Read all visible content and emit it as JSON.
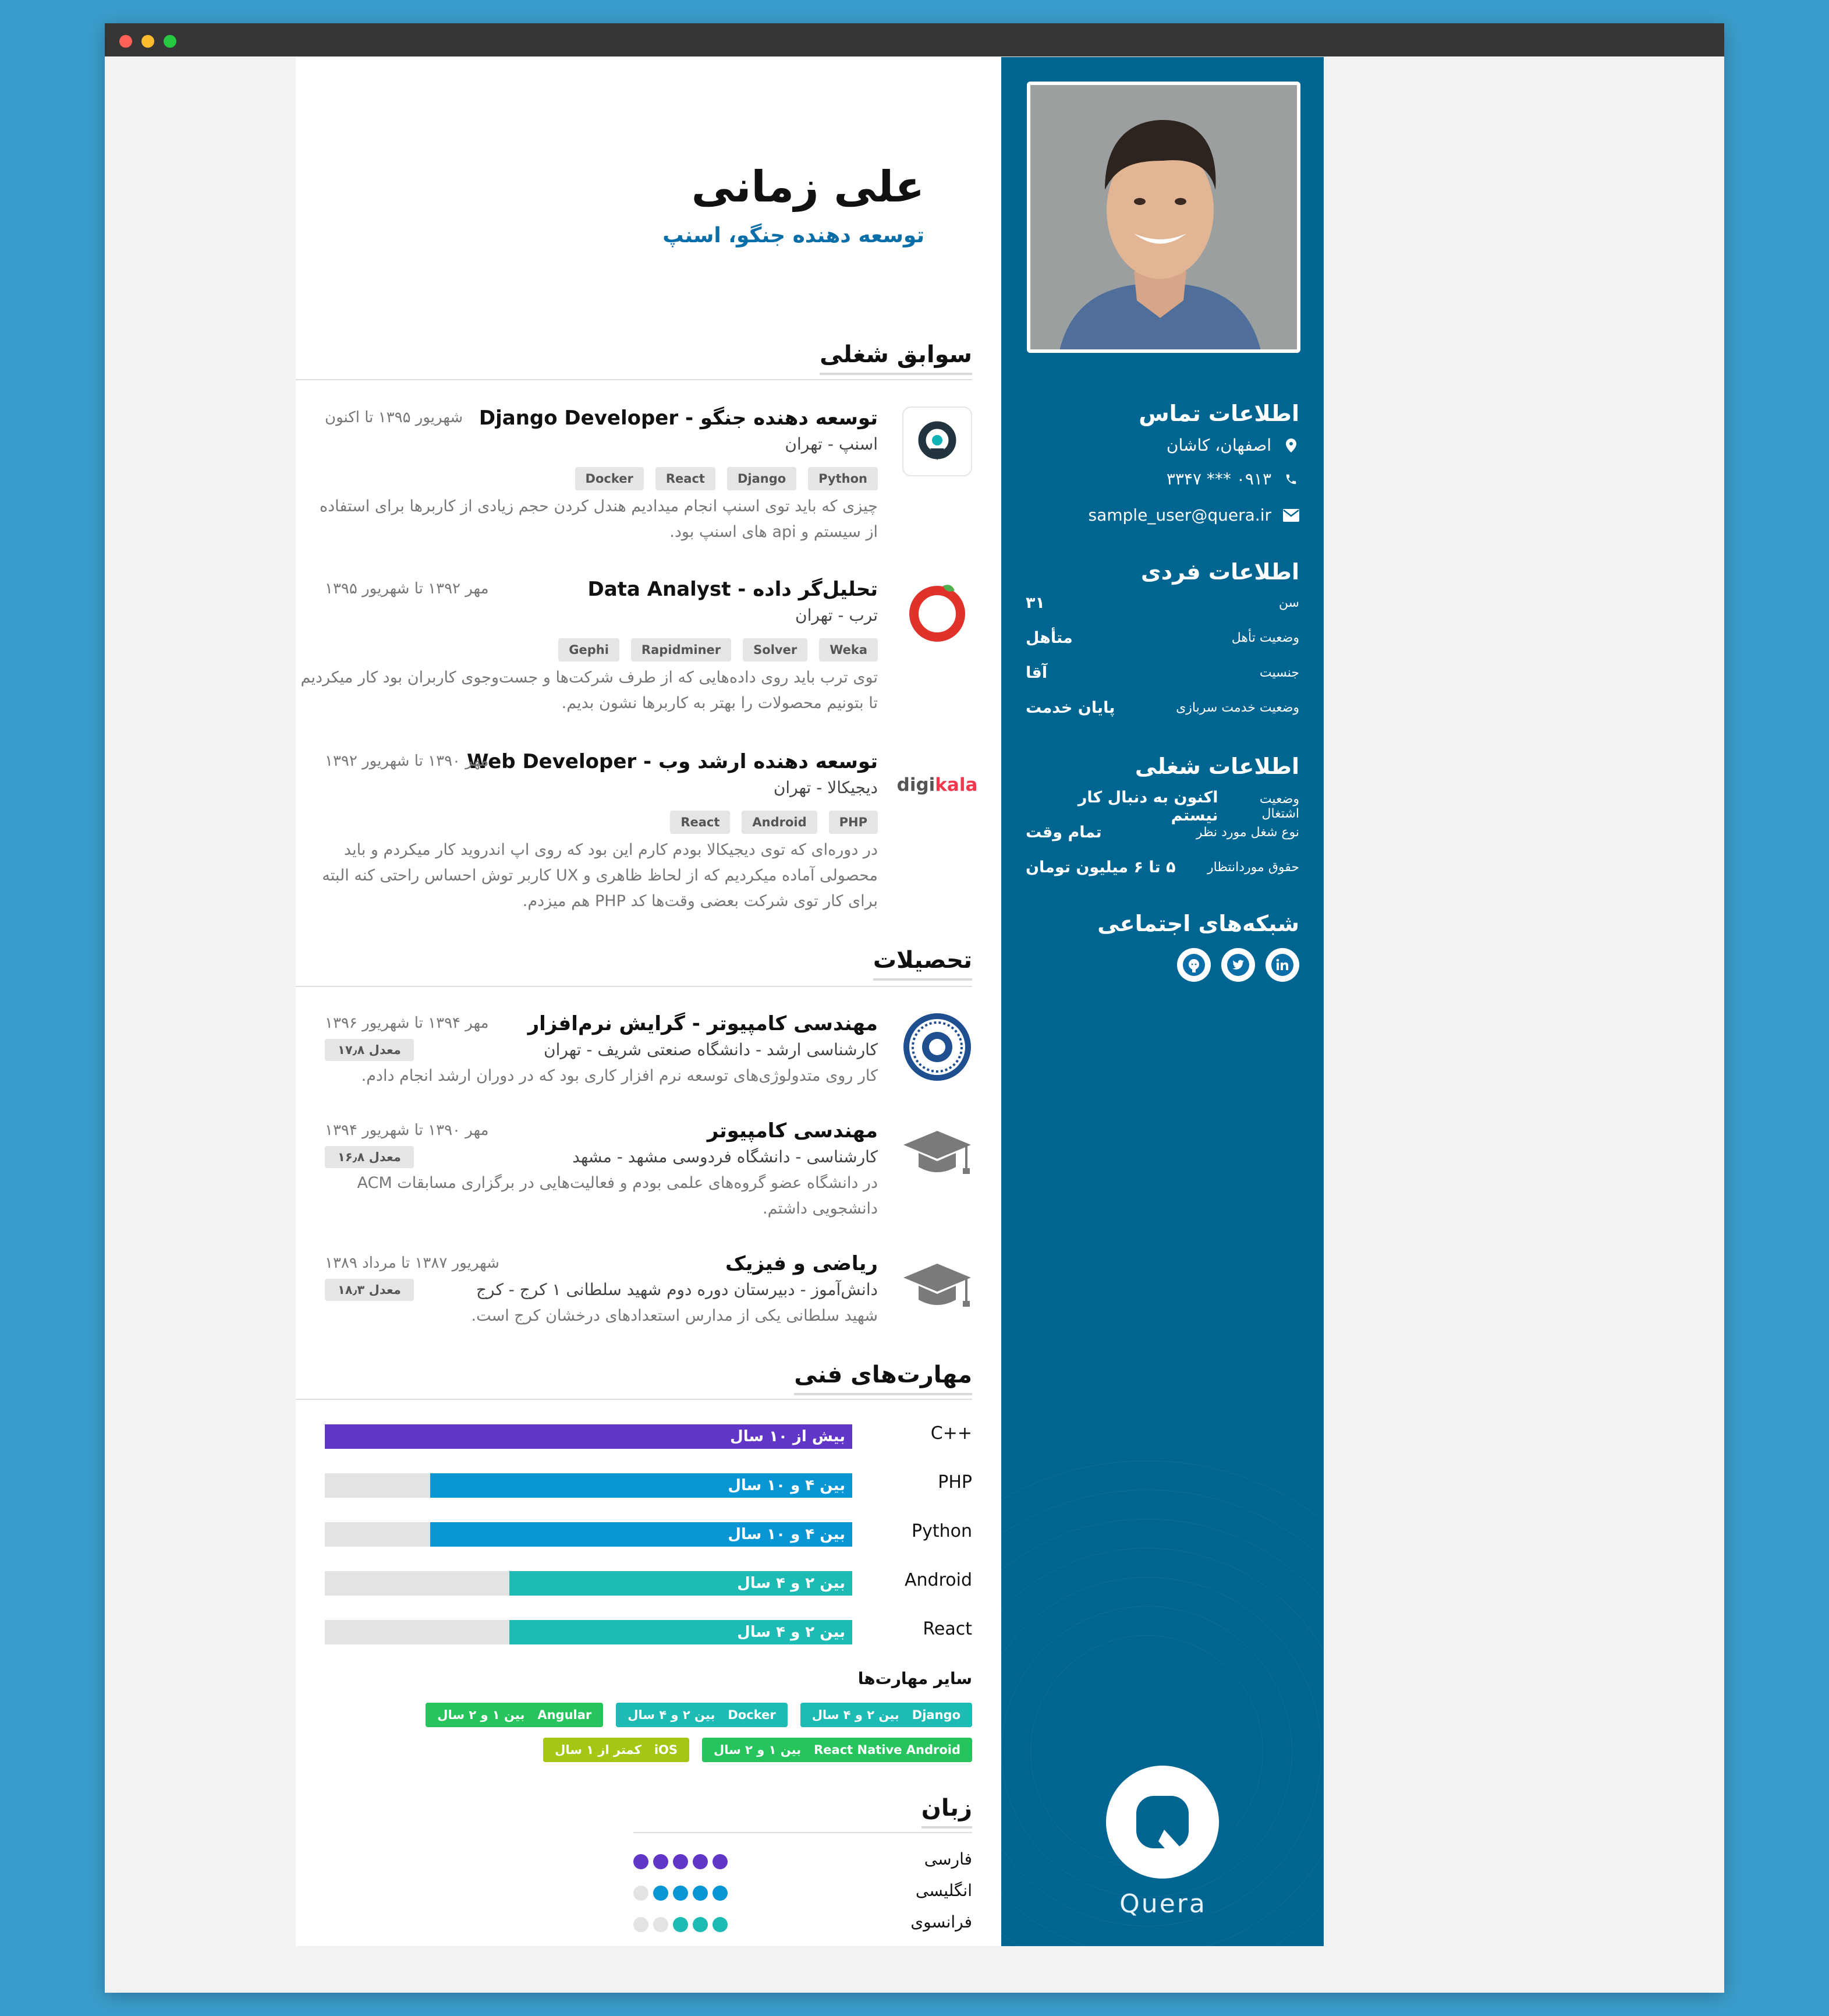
{
  "colors": {
    "sidebar": "#006591",
    "accent": "#0a6fa8",
    "purple": "#6235c9",
    "blue": "#0896d4",
    "teal": "#1ebab4",
    "green": "#27c45e",
    "lime": "#a5c713"
  },
  "header": {
    "name": "علی زمانی",
    "title": "توسعه دهنده جنگو، اسنپ"
  },
  "contact": {
    "heading": "اطلاعات تماس",
    "location": "اصفهان، کاشان",
    "phone": "۰۹۱۳ *** ۳۳۴۷",
    "email": "sample_user@quera.ir"
  },
  "personal": {
    "heading": "اطلاعات فردی",
    "rows": [
      {
        "k": "سن",
        "v": "۳۱"
      },
      {
        "k": "وضعیت تأهل",
        "v": "متأهل"
      },
      {
        "k": "جنسیت",
        "v": "آقا"
      },
      {
        "k": "وضعیت خدمت سربازی",
        "v": "پایان خدمت"
      }
    ]
  },
  "career": {
    "heading": "اطلاعات شغلی",
    "rows": [
      {
        "k": "وضعیت اشتغال",
        "v": "اکنون به دنبال کار نیستم"
      },
      {
        "k": "نوع شغل مورد نظر",
        "v": "تمام وقت"
      },
      {
        "k": "حقوق موردانتظار",
        "v": "۵ تا ۶ میلیون تومان"
      }
    ]
  },
  "social": {
    "heading": "شبکه‌های اجتماعی",
    "icons": [
      "linkedin-icon",
      "twitter-icon",
      "github-icon"
    ]
  },
  "brand": {
    "word": "Quera"
  },
  "experience": {
    "heading": "سوابق شغلی",
    "items": [
      {
        "title": "توسعه دهنده جنگو - Django Developer",
        "date": "شهریور ۱۳۹۵ تا اکنون",
        "company": "اسنپ - تهران",
        "tags": [
          "Python",
          "Django",
          "React",
          "Docker"
        ],
        "desc": [
          "چیزی که باید توی اسنپ انجام میدادیم هندل کردن حجم زیادی از کاربرها برای استفاده",
          "از سیستم و api های اسنپ بود."
        ],
        "logo": "snapp-logo"
      },
      {
        "title": "تحلیل‌گر داده - Data Analyst",
        "date": "مهر ۱۳۹۲ تا شهریور ۱۳۹۵",
        "company": "ترب - تهران",
        "tags": [
          "Weka",
          "Solver",
          "Rapidminer",
          "Gephi"
        ],
        "desc": [
          "توی ترب باید روی داده‌هایی که از طرف شرکت‌ها و جست‌وجوی کاربران بود کار میکردیم",
          "تا بتونیم محصولات را بهتر به کاربرها نشون بدیم."
        ],
        "logo": "torob-logo"
      },
      {
        "title": "توسعه دهنده ارشد وب - Web Developer",
        "date": "مهر ۱۳۹۰ تا شهریور ۱۳۹۲",
        "company": "دیجیکالا - تهران",
        "tags": [
          "PHP",
          "Android",
          "React"
        ],
        "desc": [
          "در دوره‌ای که توی دیجیکالا بودم کارم این بود که روی اپ اندروید کار میکردم و باید",
          "محصولی آماده میکردیم که از لحاظ ظاهری و UX کاربر توش احساس راحتی کنه البته",
          "برای کار توی شرکت بعضی وقت‌ها کد PHP هم میزدم."
        ],
        "logo": "digikala-logo",
        "logo_text_a": "digi",
        "logo_text_b": "kala"
      }
    ]
  },
  "education": {
    "heading": "تحصیلات",
    "items": [
      {
        "title": "مهندسی کامپیوتر - گرایش نرم‌افزار",
        "date": "مهر ۱۳۹۴ تا شهریور ۱۳۹۶",
        "school": "کارشناسی ارشد - دانشگاه صنعتی شریف - تهران",
        "gpa": "معدل ۱۷٫۸",
        "desc": [
          "کار روی متدولوژی‌های توسعه نرم افزار کاری بود که در دوران ارشد انجام دادم."
        ],
        "logo": "sharif-logo"
      },
      {
        "title": "مهندسی کامپیوتر",
        "date": "مهر ۱۳۹۰ تا شهریور ۱۳۹۴",
        "school": "کارشناسی - دانشگاه فردوسی مشهد - مشهد",
        "gpa": "معدل ۱۶٫۸",
        "desc": [
          "در دانشگاه عضو گروه‌های علمی بودم و فعالیت‌هایی در برگزاری مسابقات ACM",
          "دانشجویی داشتم."
        ],
        "logo": "graduation-cap-icon"
      },
      {
        "title": "ریاضی و فیزیک",
        "date": "شهریور ۱۳۸۷ تا مرداد ۱۳۸۹",
        "school": "دانش‌آموز - دبیرستان دوره دوم شهید سلطانی ۱ کرج - کرج",
        "gpa": "معدل ۱۸٫۳",
        "desc": [
          "شهید سلطانی یکی از مدارس استعدادهای درخشان کرج است."
        ],
        "logo": "graduation-cap-icon"
      }
    ]
  },
  "skills": {
    "heading": "مهارت‌های فنی",
    "items": [
      {
        "name": "C++",
        "label": "بیش از ۱۰ سال",
        "level": 1.0,
        "color": "#6235c9"
      },
      {
        "name": "PHP",
        "label": "بین ۴ و ۱۰ سال",
        "level": 0.8,
        "color": "#0896d4"
      },
      {
        "name": "Python",
        "label": "بین ۴ و ۱۰ سال",
        "level": 0.8,
        "color": "#0896d4"
      },
      {
        "name": "Android",
        "label": "بین ۲ و ۴ سال",
        "level": 0.65,
        "color": "#1ebab4"
      },
      {
        "name": "React",
        "label": "بین ۲ و ۴ سال",
        "level": 0.65,
        "color": "#1ebab4"
      }
    ],
    "other_heading": "سایر مهارت‌ها",
    "other": [
      {
        "name": "Django",
        "years": "بین ۲ و ۴ سال",
        "color": "#1ebab4"
      },
      {
        "name": "Docker",
        "years": "بین ۲ و ۴ سال",
        "color": "#1ebab4"
      },
      {
        "name": "Angular",
        "years": "بین ۱ و ۲ سال",
        "color": "#27c45e"
      },
      {
        "name": "React Native Android",
        "years": "بین ۱ و ۲ سال",
        "color": "#27c45e"
      },
      {
        "name": "iOS",
        "years": "کمتر از ۱ سال",
        "color": "#a5c713"
      }
    ]
  },
  "languages": {
    "heading": "زبان",
    "items": [
      {
        "name": "فارسی",
        "level": 5,
        "color": "#6235c9"
      },
      {
        "name": "انگلیسی",
        "level": 4,
        "color": "#0896d4"
      },
      {
        "name": "فرانسوی",
        "level": 3,
        "color": "#1ebab4"
      }
    ]
  }
}
